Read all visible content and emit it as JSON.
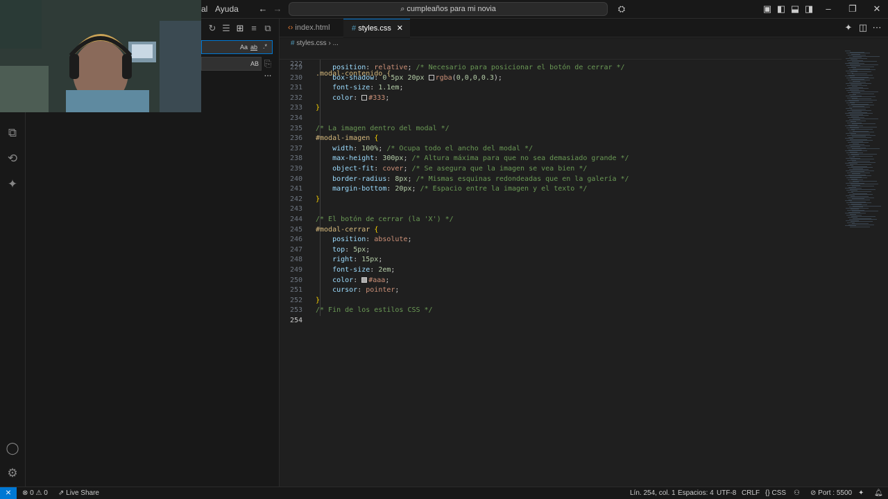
{
  "menu": {
    "partial_item": "al",
    "help": "Ayuda"
  },
  "command_center": {
    "query": "cumpleaños para mi novia"
  },
  "sidebar": {
    "search_options": [
      "Aa",
      "ab",
      ".*"
    ],
    "replace_option": "AB",
    "more": "..."
  },
  "tabs": [
    {
      "label": "index.html",
      "icon": "html-icon"
    },
    {
      "label": "styles.css",
      "icon": "css-hash-icon",
      "active": true
    }
  ],
  "breadcrumb": {
    "file": "styles.css",
    "more": "..."
  },
  "sticky_line": {
    "number": "222",
    "text": ".modal-contenido {"
  },
  "code_lines": [
    {
      "n": "229",
      "tokens": [
        [
          "prop",
          "    position"
        ],
        [
          "pun",
          ": "
        ],
        [
          "val",
          "relative"
        ],
        [
          "pun",
          "; "
        ],
        [
          "cmt",
          "/* Necesario para posicionar el botón de cerrar */"
        ]
      ]
    },
    {
      "n": "230",
      "tokens": [
        [
          "prop",
          "    box-shadow"
        ],
        [
          "pun",
          ": "
        ],
        [
          "num",
          "0 5px 20px "
        ],
        [
          "swatch",
          ""
        ],
        [
          "val",
          "rgba"
        ],
        [
          "pun",
          "("
        ],
        [
          "num",
          "0,0,0,0.3"
        ],
        [
          "pun",
          ");"
        ]
      ]
    },
    {
      "n": "231",
      "tokens": [
        [
          "prop",
          "    font-size"
        ],
        [
          "pun",
          ": "
        ],
        [
          "num",
          "1.1em"
        ],
        [
          "pun",
          ";"
        ]
      ]
    },
    {
      "n": "232",
      "tokens": [
        [
          "prop",
          "    color"
        ],
        [
          "pun",
          ": "
        ],
        [
          "swatch",
          ""
        ],
        [
          "val",
          "#333"
        ],
        [
          "pun",
          ";"
        ]
      ]
    },
    {
      "n": "233",
      "tokens": [
        [
          "brace",
          "}"
        ]
      ]
    },
    {
      "n": "234",
      "tokens": []
    },
    {
      "n": "235",
      "tokens": [
        [
          "cmt",
          "/* La imagen dentro del modal */"
        ]
      ]
    },
    {
      "n": "236",
      "tokens": [
        [
          "sel",
          "#modal-imagen"
        ],
        [
          "pun",
          " "
        ],
        [
          "brace",
          "{"
        ]
      ]
    },
    {
      "n": "237",
      "tokens": [
        [
          "prop",
          "    width"
        ],
        [
          "pun",
          ": "
        ],
        [
          "num",
          "100%"
        ],
        [
          "pun",
          "; "
        ],
        [
          "cmt",
          "/* Ocupa todo el ancho del modal */"
        ]
      ]
    },
    {
      "n": "238",
      "tokens": [
        [
          "prop",
          "    max-height"
        ],
        [
          "pun",
          ": "
        ],
        [
          "num",
          "300px"
        ],
        [
          "pun",
          "; "
        ],
        [
          "cmt",
          "/* Altura máxima para que no sea demasiado grande */"
        ]
      ]
    },
    {
      "n": "239",
      "tokens": [
        [
          "prop",
          "    object-fit"
        ],
        [
          "pun",
          ": "
        ],
        [
          "val",
          "cover"
        ],
        [
          "pun",
          "; "
        ],
        [
          "cmt",
          "/* Se asegura que la imagen se vea bien */"
        ]
      ]
    },
    {
      "n": "240",
      "tokens": [
        [
          "prop",
          "    border-radius"
        ],
        [
          "pun",
          ": "
        ],
        [
          "num",
          "8px"
        ],
        [
          "pun",
          "; "
        ],
        [
          "cmt",
          "/* Mismas esquinas redondeadas que en la galería */"
        ]
      ]
    },
    {
      "n": "241",
      "tokens": [
        [
          "prop",
          "    margin-bottom"
        ],
        [
          "pun",
          ": "
        ],
        [
          "num",
          "20px"
        ],
        [
          "pun",
          "; "
        ],
        [
          "cmt",
          "/* Espacio entre la imagen y el texto */"
        ]
      ]
    },
    {
      "n": "242",
      "tokens": [
        [
          "brace",
          "}"
        ]
      ]
    },
    {
      "n": "243",
      "tokens": []
    },
    {
      "n": "244",
      "tokens": [
        [
          "cmt",
          "/* El botón de cerrar (la 'X') */"
        ]
      ]
    },
    {
      "n": "245",
      "tokens": [
        [
          "sel",
          "#modal-cerrar"
        ],
        [
          "pun",
          " "
        ],
        [
          "brace",
          "{"
        ]
      ]
    },
    {
      "n": "246",
      "tokens": [
        [
          "prop",
          "    position"
        ],
        [
          "pun",
          ": "
        ],
        [
          "val",
          "absolute"
        ],
        [
          "pun",
          ";"
        ]
      ]
    },
    {
      "n": "247",
      "tokens": [
        [
          "prop",
          "    top"
        ],
        [
          "pun",
          ": "
        ],
        [
          "num",
          "5px"
        ],
        [
          "pun",
          ";"
        ]
      ]
    },
    {
      "n": "248",
      "tokens": [
        [
          "prop",
          "    right"
        ],
        [
          "pun",
          ": "
        ],
        [
          "num",
          "15px"
        ],
        [
          "pun",
          ";"
        ]
      ]
    },
    {
      "n": "249",
      "tokens": [
        [
          "prop",
          "    font-size"
        ],
        [
          "pun",
          ": "
        ],
        [
          "num",
          "2em"
        ],
        [
          "pun",
          ";"
        ]
      ]
    },
    {
      "n": "250",
      "tokens": [
        [
          "prop",
          "    color"
        ],
        [
          "pun",
          ": "
        ],
        [
          "swatchgray",
          ""
        ],
        [
          "val",
          "#aaa"
        ],
        [
          "pun",
          ";"
        ]
      ]
    },
    {
      "n": "251",
      "tokens": [
        [
          "prop",
          "    cursor"
        ],
        [
          "pun",
          ": "
        ],
        [
          "val",
          "pointer"
        ],
        [
          "pun",
          ";"
        ]
      ]
    },
    {
      "n": "252",
      "tokens": [
        [
          "brace",
          "}"
        ]
      ]
    },
    {
      "n": "253",
      "tokens": [
        [
          "cmt",
          "/* Fin de los estilos CSS */"
        ]
      ]
    },
    {
      "n": "254",
      "tokens": [],
      "current": true
    }
  ],
  "status": {
    "errors": "0",
    "warnings": "0",
    "live_share": "Live Share",
    "position": "Lín. 254, col. 1",
    "spaces": "Espacios: 4",
    "encoding": "UTF-8",
    "eol": "CRLF",
    "language": "CSS",
    "port": "Port : 5500"
  },
  "colors": {
    "accent": "#0078d4",
    "background": "#1f1f1f"
  }
}
